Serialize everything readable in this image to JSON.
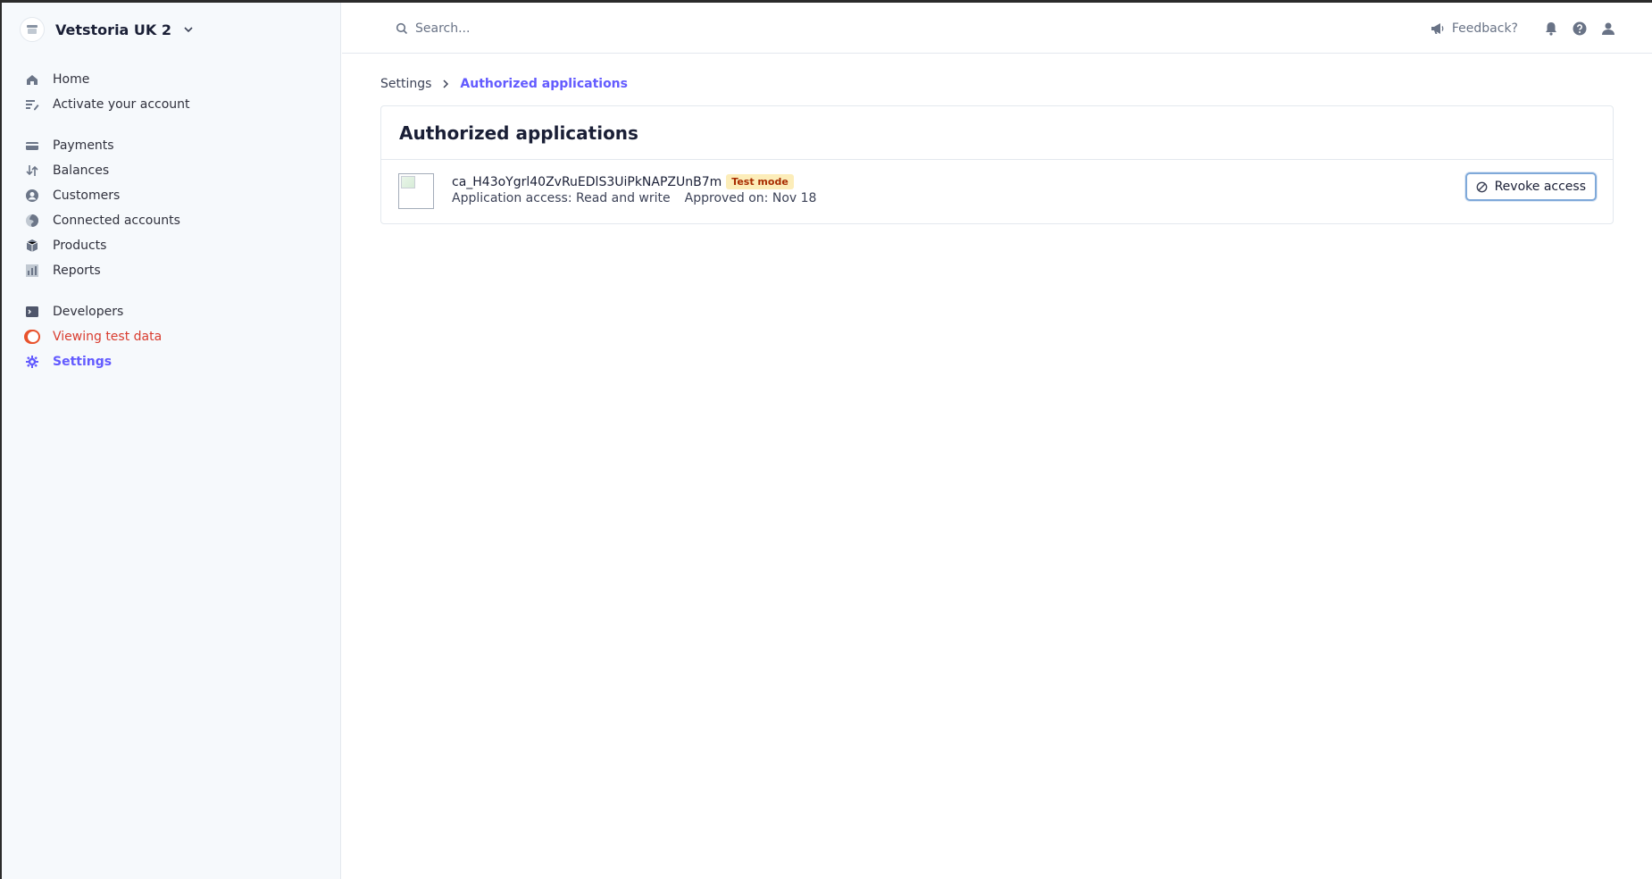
{
  "account": {
    "name": "Vetstoria UK 2",
    "logo_icon": "store-icon"
  },
  "sidebar": {
    "groups": [
      [
        {
          "label": "Home",
          "icon": "home-icon"
        },
        {
          "label": "Activate your account",
          "icon": "activate-icon"
        }
      ],
      [
        {
          "label": "Payments",
          "icon": "payments-icon"
        },
        {
          "label": "Balances",
          "icon": "balances-icon"
        },
        {
          "label": "Customers",
          "icon": "customers-icon"
        },
        {
          "label": "Connected accounts",
          "icon": "globe-icon"
        },
        {
          "label": "Products",
          "icon": "box-icon"
        },
        {
          "label": "Reports",
          "icon": "reports-icon"
        }
      ],
      [
        {
          "label": "Developers",
          "icon": "terminal-icon"
        },
        {
          "label": "Viewing test data",
          "icon": "toggle-icon"
        },
        {
          "label": "Settings",
          "icon": "gear-icon"
        }
      ]
    ]
  },
  "topbar": {
    "search_placeholder": "Search...",
    "feedback_label": "Feedback?"
  },
  "breadcrumb": {
    "parent": "Settings",
    "current": "Authorized applications"
  },
  "card": {
    "title": "Authorized applications",
    "application": {
      "id": "ca_H43oYgrl40ZvRuEDlS3UiPkNAPZUnB7m",
      "badge": "Test mode",
      "access": "Application access: Read and write",
      "approved": "Approved on: Nov 18",
      "revoke_label": "Revoke access"
    }
  },
  "colors": {
    "accent": "#635bff",
    "test_data": "#d93c2f",
    "badge_bg": "#fcedb9",
    "badge_text": "#a82c00"
  }
}
